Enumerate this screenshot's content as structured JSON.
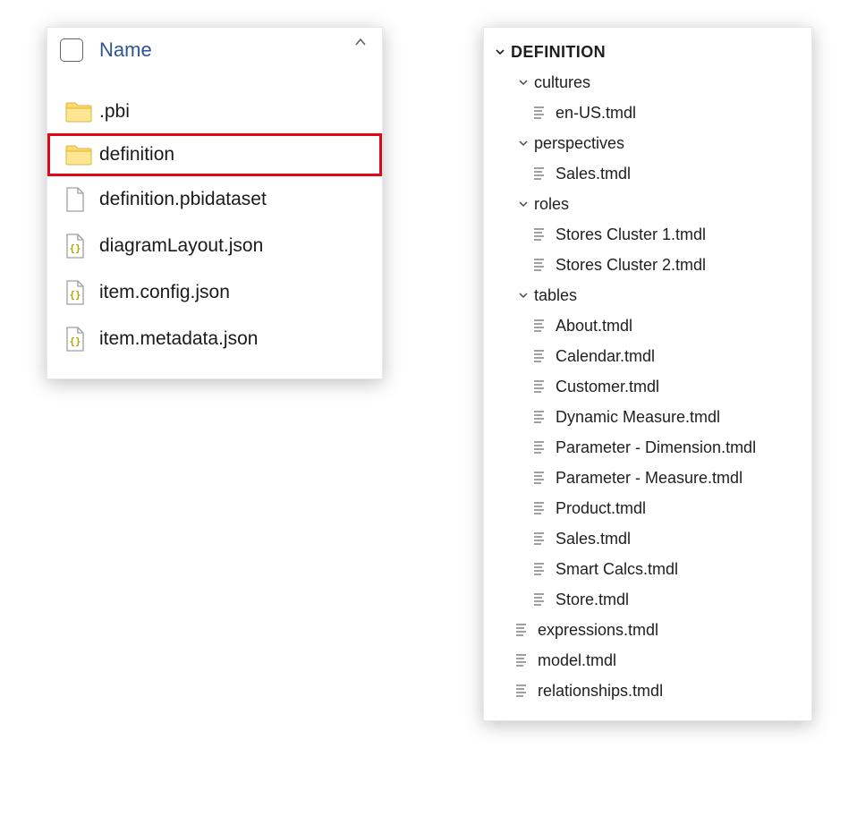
{
  "left": {
    "header": "Name",
    "items": [
      {
        "type": "folder",
        "label": ".pbi",
        "highlighted": false
      },
      {
        "type": "folder",
        "label": "definition",
        "highlighted": true
      },
      {
        "type": "file",
        "label": "definition.pbidataset"
      },
      {
        "type": "json",
        "label": "diagramLayout.json"
      },
      {
        "type": "json",
        "label": "item.config.json"
      },
      {
        "type": "json",
        "label": "item.metadata.json"
      }
    ]
  },
  "right": {
    "root": "DEFINITION",
    "nodes": [
      {
        "depth": 1,
        "kind": "folder",
        "label": "cultures"
      },
      {
        "depth": 2,
        "kind": "file",
        "label": "en-US.tmdl"
      },
      {
        "depth": 1,
        "kind": "folder",
        "label": "perspectives"
      },
      {
        "depth": 2,
        "kind": "file",
        "label": "Sales.tmdl"
      },
      {
        "depth": 1,
        "kind": "folder",
        "label": "roles"
      },
      {
        "depth": 2,
        "kind": "file",
        "label": "Stores Cluster 1.tmdl"
      },
      {
        "depth": 2,
        "kind": "file",
        "label": "Stores Cluster 2.tmdl"
      },
      {
        "depth": 1,
        "kind": "folder",
        "label": "tables"
      },
      {
        "depth": 2,
        "kind": "file",
        "label": "About.tmdl"
      },
      {
        "depth": 2,
        "kind": "file",
        "label": "Calendar.tmdl"
      },
      {
        "depth": 2,
        "kind": "file",
        "label": "Customer.tmdl"
      },
      {
        "depth": 2,
        "kind": "file",
        "label": "Dynamic Measure.tmdl"
      },
      {
        "depth": 2,
        "kind": "file",
        "label": "Parameter - Dimension.tmdl"
      },
      {
        "depth": 2,
        "kind": "file",
        "label": "Parameter - Measure.tmdl"
      },
      {
        "depth": 2,
        "kind": "file",
        "label": "Product.tmdl"
      },
      {
        "depth": 2,
        "kind": "file",
        "label": "Sales.tmdl"
      },
      {
        "depth": 2,
        "kind": "file",
        "label": "Smart Calcs.tmdl"
      },
      {
        "depth": 2,
        "kind": "file",
        "label": "Store.tmdl"
      },
      {
        "depth": 1,
        "kind": "file",
        "label": "expressions.tmdl"
      },
      {
        "depth": 1,
        "kind": "file",
        "label": "model.tmdl"
      },
      {
        "depth": 1,
        "kind": "file",
        "label": "relationships.tmdl"
      }
    ]
  }
}
